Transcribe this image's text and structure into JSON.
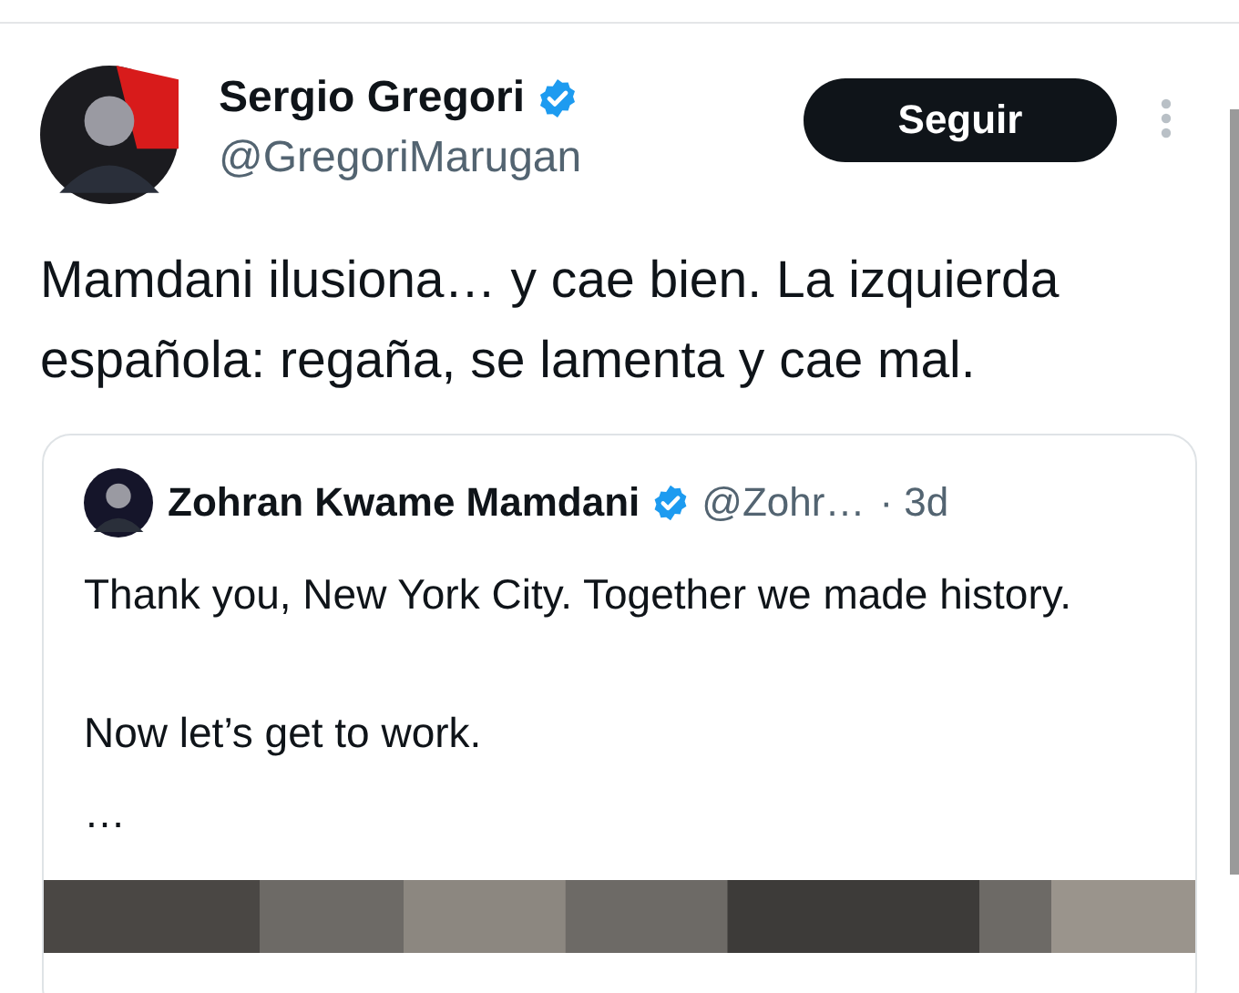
{
  "post": {
    "author": {
      "name": "Sergio Gregori",
      "verified": true,
      "handle": "@GregoriMarugan"
    },
    "follow_button": "Seguir",
    "text": "Mamdani ilusiona… y cae bien. La izquierda española: regaña, se lamenta y cae mal.",
    "quoted_post": {
      "author": {
        "name": "Zohran Kwame Mamdani",
        "verified": true,
        "handle": "@Zohr…",
        "time": "· 3d"
      },
      "paragraphs": [
        "Thank you, New York City. Together we made history.",
        "Now let’s get to work.",
        "…"
      ]
    }
  }
}
